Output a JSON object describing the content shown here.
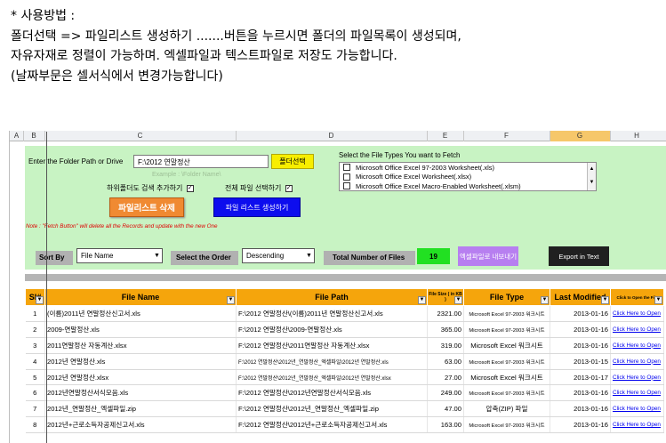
{
  "instructions": [
    "*  사용방법 :",
    "폴더선택 => 파일리스트 생성하기 .......버튼을 누르시면 폴더의 파일목록이 생성되며,",
    "자유자재로 정렬이 가능하며. 엑셀파일과 텍스트파일로 저장도 가능합니다.",
    "(날짜부문은 셀서식에서 변경가능합니다)"
  ],
  "columns": [
    "A",
    "B",
    "C",
    "D",
    "E",
    "F",
    "G",
    "H"
  ],
  "form": {
    "folder_label": "Enter the Folder Path or Drive",
    "folder_value": "F:\\2012 연말정산",
    "folder_button": "폴더선택",
    "example_hint": "Example : \\Folder Name\\",
    "subfolder_label": "하위폴더도 검색 추가하기",
    "select_all_label": "전체 파일 선택하기",
    "delete_button": "파일리스트 삭제",
    "generate_button": "파일 리스트 생성하기",
    "file_types_title": "Select the File Types You want to Fetch",
    "file_types": [
      "Microsoft Office Excel 97-2003 Worksheet(.xls)",
      "Microsoft Office Excel Worksheet(.xlsx)",
      "Microsoft Office Excel Macro-Enabled Worksheet(.xlsm)"
    ],
    "note": "Note : \"Fetch Button\" will delete all the Records and update with the new One",
    "sort_by_label": "Sort By",
    "sort_by_value": "File Name",
    "order_label": "Select the Order",
    "order_value": "Descending",
    "total_label": "Total Number of Files",
    "total_value": "19",
    "export_excel_button": "엑셀파일로 내보내기",
    "export_text_button": "Export in Text",
    "accent_green": "#c8f3c3",
    "header_orange": "#f5a50c"
  },
  "table": {
    "headers": [
      "SI#",
      "File Name",
      "File Path",
      "File Size ( in KB )",
      "File Type",
      "Last Modified",
      "Click to Open the File"
    ],
    "rows": [
      [
        "1",
        "(이름)2011년 연말정산신고서.xls",
        "F:\\2012 연말정산\\(이름)2011년 연말정산신고서.xls",
        "2321.00",
        "Microsoft Excel 97-2003 워크시트",
        "2013-01-16",
        "Click Here to Open"
      ],
      [
        "2",
        "2009-연말정산.xls",
        "F:\\2012 연말정산\\2009-연말정산.xls",
        "365.00",
        "Microsoft Excel 97-2003 워크시트",
        "2013-01-16",
        "Click Here to Open"
      ],
      [
        "3",
        "2011연말정산 자동계산.xlsx",
        "F:\\2012 연말정산\\2011연말정산 자동계산.xlsx",
        "319.00",
        "Microsoft Excel 워크시트",
        "2013-01-16",
        "Click Here to Open"
      ],
      [
        "4",
        "2012년 연말정산.xls",
        "F:\\2012 연말정산\\2012년_연말정산_엑셀파일\\2012년 연말정산.xls",
        "63.00",
        "Microsoft Excel 97-2003 워크시트",
        "2013-01-15",
        "Click Here to Open"
      ],
      [
        "5",
        "2012년 연말정산.xlsx",
        "F:\\2012 연말정산\\2012년_연말정산_엑셀파일\\2012년 연말정산.xlsx",
        "27.00",
        "Microsoft Excel 워크시트",
        "2013-01-17",
        "Click Here to Open"
      ],
      [
        "6",
        "2012년연말정산서식모음.xls",
        "F:\\2012 연말정산\\2012년연말정산서식모음.xls",
        "249.00",
        "Microsoft Excel 97-2003 워크시트",
        "2013-01-16",
        "Click Here to Open"
      ],
      [
        "7",
        "2012년_연말정산_엑셀파일.zip",
        "F:\\2012 연말정산\\2012년_연말정산_엑셀파일.zip",
        "47.00",
        "압축(ZIP) 파일",
        "2013-01-16",
        "Click Here to Open"
      ],
      [
        "8",
        "2012년+근로소득자공제신고서.xls",
        "F:\\2012 연말정산\\2012년+근로소득자공제신고서.xls",
        "163.00",
        "Microsoft Excel 97-2003 워크시트",
        "2013-01-16",
        "Click Here to Open"
      ]
    ]
  }
}
